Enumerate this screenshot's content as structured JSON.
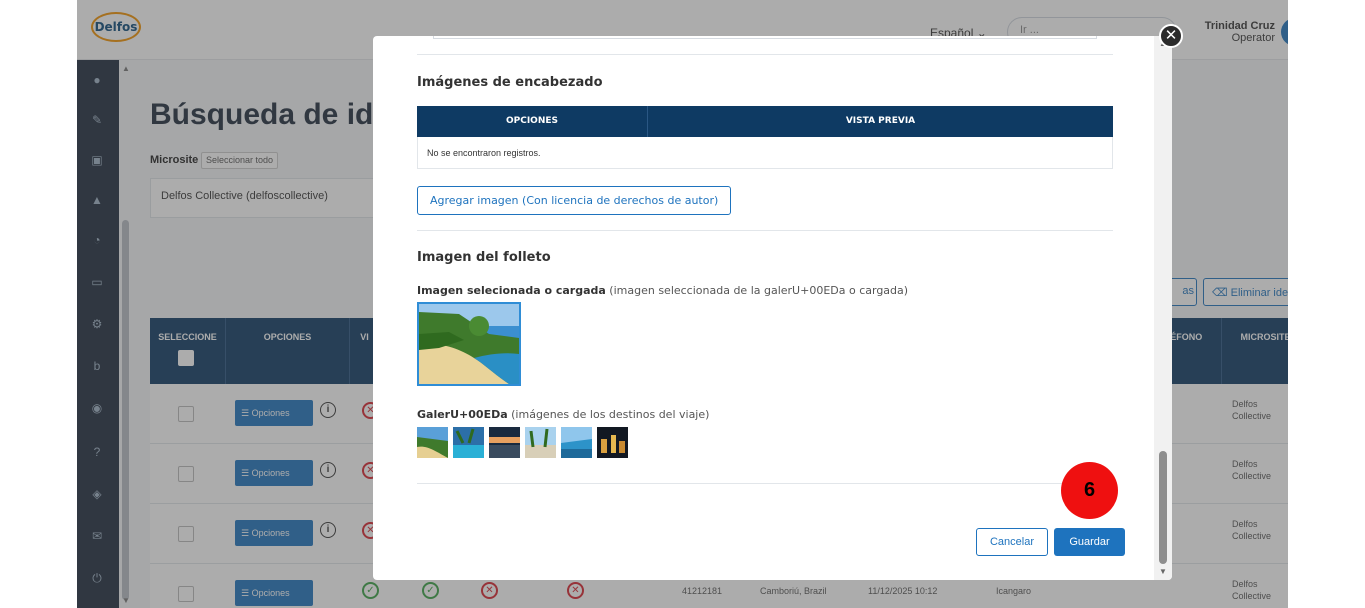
{
  "header": {
    "logo_text": "Delfos",
    "language": "Español ⌄",
    "search_placeholder": "Ir ...",
    "user_name": "Trinidad Cruz",
    "user_role": "Operator"
  },
  "background_page": {
    "title": "Búsqueda de id",
    "microsite_label": "Microsite",
    "select_all": "Seleccionar todo",
    "microsite_value": "Delfos Collective (delfoscollective)",
    "action_btn_1": "as",
    "action_btn_2": "Eliminar ide",
    "grid_headers": [
      "SELECCIONE",
      "OPCIONES",
      "VI",
      "LÉFONO",
      "MICROSITE"
    ],
    "row_option_label": "Opciones",
    "row_site": "Delfos Collective",
    "last_row": {
      "id": "41212181",
      "location": "Camboriú, Brazil",
      "datetime": "11/12/2025 10:12",
      "name": "Icangaro"
    }
  },
  "modal": {
    "header_images_title": "Imágenes de encabezado",
    "table_headers": [
      "OPCIONES",
      "VISTA PREVIA"
    ],
    "no_records": "No se encontraron registros.",
    "add_image_button": "Agregar imagen (Con licencia de derechos de autor)",
    "brochure_title": "Imagen del folleto",
    "selected_label_bold": "Imagen selecionada o cargada",
    "selected_label_rest": " (imagen seleccionada de la galerU+00EDa o cargada)",
    "gallery_label_bold": "GalerU+00EDa",
    "gallery_label_rest": " (imágenes de los destinos del viaje)",
    "cancel_button": "Cancelar",
    "save_button": "Guardar",
    "close_glyph": "✕"
  },
  "annotation": {
    "step_number": "6"
  },
  "colors": {
    "primary": "#1e73be",
    "table_header": "#0e3a63",
    "sidebar": "#1e2b3c",
    "badge": "#ef1010",
    "error": "#d9232e",
    "success": "#3aa346"
  }
}
